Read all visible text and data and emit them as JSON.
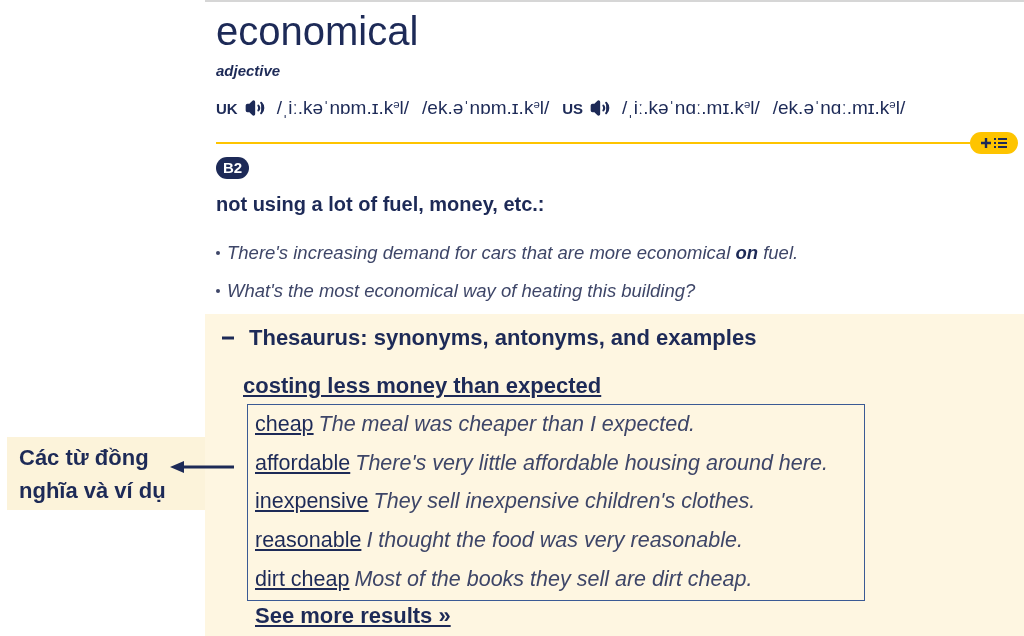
{
  "entry": {
    "headword": "economical",
    "part_of_speech": "adjective",
    "pronunciations": [
      {
        "region": "UK",
        "ipa": [
          "/ˌiː.kəˈnɒm.ɪ.k$^{ə}$l/",
          "/ek.əˈnɒm.ɪ.k$^{ə}$l/"
        ]
      },
      {
        "region": "US",
        "ipa": [
          "/ˌiː.kəˈnɑː.mɪ.k$^{ə}$l/",
          "/ek.əˈnɑː.mɪ.k$^{ə}$l/"
        ]
      }
    ]
  },
  "sense": {
    "cefr": "B2",
    "definition": "not using a lot of fuel, money, etc.:",
    "examples": [
      "There's increasing demand for cars that are more economical **on** fuel.",
      "What's the most economical way of heating this building?"
    ]
  },
  "thesaurus": {
    "expanded": true,
    "title": "Thesaurus: synonyms, antonyms, and examples",
    "heading": "costing less money than expected",
    "entries": [
      {
        "word": "cheap",
        "example": "The meal was cheaper than I expected."
      },
      {
        "word": "affordable",
        "example": "There's very little affordable housing around here."
      },
      {
        "word": "inexpensive",
        "example": "They sell inexpensive children's clothes."
      },
      {
        "word": "reasonable",
        "example": "I thought the food was very reasonable."
      },
      {
        "word": "dirt cheap",
        "example": "Most of the books they sell are dirt cheap."
      }
    ],
    "more_link": "See more results »"
  },
  "annotation": {
    "text": "Các từ đồng nghĩa và ví dụ"
  }
}
